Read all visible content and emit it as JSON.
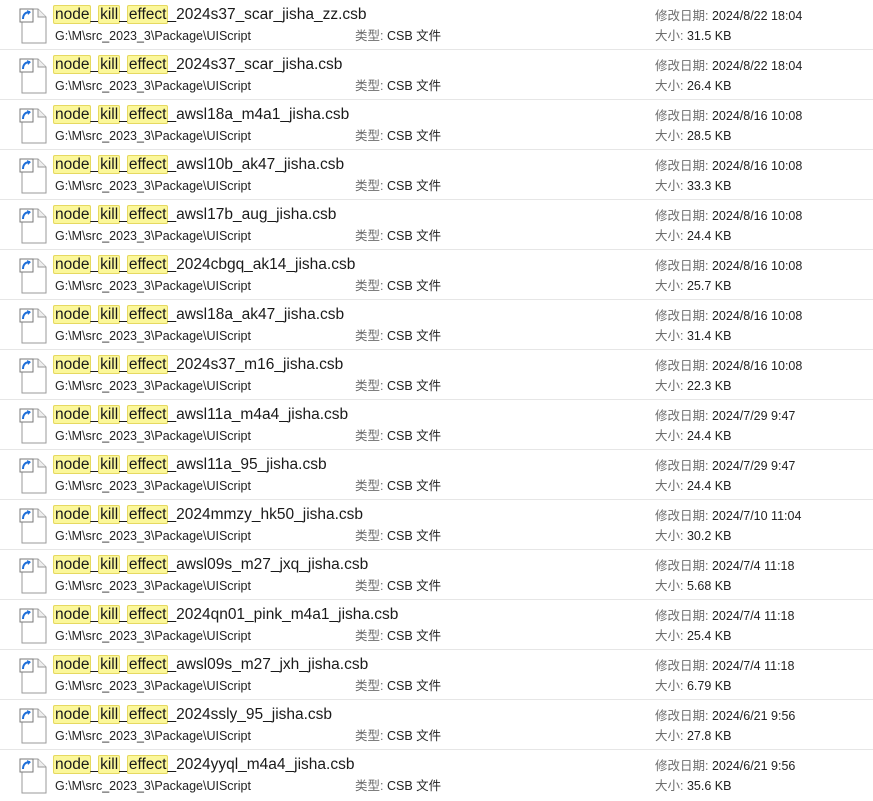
{
  "labels": {
    "type": "类型:",
    "modified": "修改日期:",
    "size": "大小:"
  },
  "search_term_parts": [
    "node",
    "kill",
    "effect"
  ],
  "files": [
    {
      "name_suffix": "2024s37_scar_jisha_zz.csb",
      "path": "G:\\M\\src_2023_3\\Package\\UIScript",
      "type": "CSB 文件",
      "modified": "2024/8/22 18:04",
      "size": "31.5 KB"
    },
    {
      "name_suffix": "2024s37_scar_jisha.csb",
      "path": "G:\\M\\src_2023_3\\Package\\UIScript",
      "type": "CSB 文件",
      "modified": "2024/8/22 18:04",
      "size": "26.4 KB"
    },
    {
      "name_suffix": "awsl18a_m4a1_jisha.csb",
      "path": "G:\\M\\src_2023_3\\Package\\UIScript",
      "type": "CSB 文件",
      "modified": "2024/8/16 10:08",
      "size": "28.5 KB"
    },
    {
      "name_suffix": "awsl10b_ak47_jisha.csb",
      "path": "G:\\M\\src_2023_3\\Package\\UIScript",
      "type": "CSB 文件",
      "modified": "2024/8/16 10:08",
      "size": "33.3 KB"
    },
    {
      "name_suffix": "awsl17b_aug_jisha.csb",
      "path": "G:\\M\\src_2023_3\\Package\\UIScript",
      "type": "CSB 文件",
      "modified": "2024/8/16 10:08",
      "size": "24.4 KB"
    },
    {
      "name_suffix": "2024cbgq_ak14_jisha.csb",
      "path": "G:\\M\\src_2023_3\\Package\\UIScript",
      "type": "CSB 文件",
      "modified": "2024/8/16 10:08",
      "size": "25.7 KB"
    },
    {
      "name_suffix": "awsl18a_ak47_jisha.csb",
      "path": "G:\\M\\src_2023_3\\Package\\UIScript",
      "type": "CSB 文件",
      "modified": "2024/8/16 10:08",
      "size": "31.4 KB"
    },
    {
      "name_suffix": "2024s37_m16_jisha.csb",
      "path": "G:\\M\\src_2023_3\\Package\\UIScript",
      "type": "CSB 文件",
      "modified": "2024/8/16 10:08",
      "size": "22.3 KB"
    },
    {
      "name_suffix": "awsl11a_m4a4_jisha.csb",
      "path": "G:\\M\\src_2023_3\\Package\\UIScript",
      "type": "CSB 文件",
      "modified": "2024/7/29 9:47",
      "size": "24.4 KB"
    },
    {
      "name_suffix": "awsl11a_95_jisha.csb",
      "path": "G:\\M\\src_2023_3\\Package\\UIScript",
      "type": "CSB 文件",
      "modified": "2024/7/29 9:47",
      "size": "24.4 KB"
    },
    {
      "name_suffix": "2024mmzy_hk50_jisha.csb",
      "path": "G:\\M\\src_2023_3\\Package\\UIScript",
      "type": "CSB 文件",
      "modified": "2024/7/10 11:04",
      "size": "30.2 KB"
    },
    {
      "name_suffix": "awsl09s_m27_jxq_jisha.csb",
      "path": "G:\\M\\src_2023_3\\Package\\UIScript",
      "type": "CSB 文件",
      "modified": "2024/7/4 11:18",
      "size": "5.68 KB"
    },
    {
      "name_suffix": "2024qn01_pink_m4a1_jisha.csb",
      "path": "G:\\M\\src_2023_3\\Package\\UIScript",
      "type": "CSB 文件",
      "modified": "2024/7/4 11:18",
      "size": "25.4 KB"
    },
    {
      "name_suffix": "awsl09s_m27_jxh_jisha.csb",
      "path": "G:\\M\\src_2023_3\\Package\\UIScript",
      "type": "CSB 文件",
      "modified": "2024/7/4 11:18",
      "size": "6.79 KB"
    },
    {
      "name_suffix": "2024ssly_95_jisha.csb",
      "path": "G:\\M\\src_2023_3\\Package\\UIScript",
      "type": "CSB 文件",
      "modified": "2024/6/21 9:56",
      "size": "27.8 KB"
    },
    {
      "name_suffix": "2024yyql_m4a4_jisha.csb",
      "path": "G:\\M\\src_2023_3\\Package\\UIScript",
      "type": "CSB 文件",
      "modified": "2024/6/21 9:56",
      "size": "35.6 KB"
    }
  ],
  "icons": {
    "file": "file-shortcut-icon"
  },
  "colors": {
    "highlight": "#fbf79a",
    "highlight_border": "#e6d960",
    "divider": "#e6e6e6",
    "shortcut_arrow": "#1e6fd9"
  }
}
